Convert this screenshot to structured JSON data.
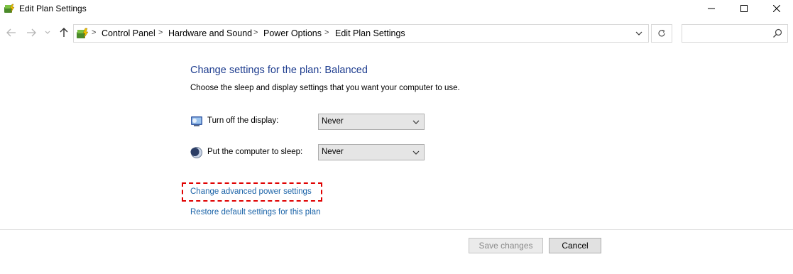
{
  "window": {
    "title": "Edit Plan Settings",
    "icon": "power-options-icon"
  },
  "nav": {
    "back": "arrow-left-icon",
    "forward": "arrow-right-icon",
    "up": "arrow-up-icon"
  },
  "address": {
    "crumbs": [
      "Control Panel",
      "Hardware and Sound",
      "Power Options",
      "Edit Plan Settings"
    ],
    "separator": ">"
  },
  "search": {
    "value": "",
    "placeholder": ""
  },
  "content": {
    "heading": "Change settings for the plan: Balanced",
    "description": "Choose the sleep and display settings that you want your computer to use.",
    "display_label": "Turn off the display:",
    "display_value": "Never",
    "sleep_label": "Put the computer to sleep:",
    "sleep_value": "Never",
    "advanced_link": "Change advanced power settings",
    "restore_link": "Restore default settings for this plan"
  },
  "buttons": {
    "save": "Save changes",
    "cancel": "Cancel"
  },
  "colors": {
    "heading": "#1e3d8f",
    "link": "#1a63a8",
    "highlight": "#e00000"
  }
}
